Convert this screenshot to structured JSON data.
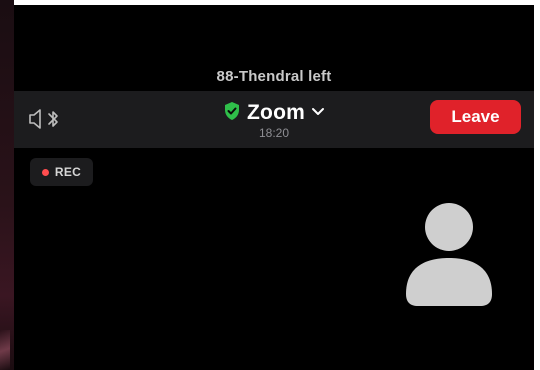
{
  "notification": {
    "text": "88-Thendral left"
  },
  "topbar": {
    "title": "Zoom",
    "subtitle": "18:20",
    "leave_label": "Leave",
    "icons": {
      "speaker": "speaker-muted-icon",
      "bluetooth": "bluetooth-icon",
      "security": "shield-check-icon",
      "chevron": "chevron-down-icon"
    }
  },
  "recording": {
    "label": "REC"
  },
  "participant": {
    "avatar_icon": "person-avatar-icon"
  },
  "colors": {
    "leave": "#e0222a",
    "shield": "#2fbf4a",
    "rec_dot": "#ff4d4f",
    "bar_bg": "#1c1c1e",
    "avatar": "#cfcfcf"
  }
}
